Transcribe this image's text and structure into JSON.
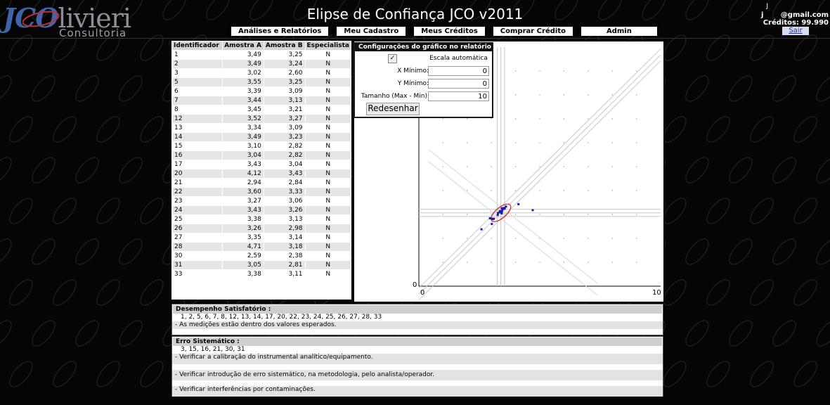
{
  "header": {
    "logo_main": "JCOlivieri",
    "logo_jco": "JCO",
    "logo_rest": "livieri",
    "logo_sub": "Consultoria",
    "title": "Elipse de Confiança JCO v2011"
  },
  "nav": {
    "items": [
      "Análises e Relatórios",
      "Meu Cadastro",
      "Meus Créditos",
      "Comprar Crédito",
      "Admin"
    ]
  },
  "user": {
    "name": "J",
    "email_prefix": "j",
    "email": "@gmail.com",
    "credits": "Créditos: 99.990",
    "logout": "Sair"
  },
  "table": {
    "headers": [
      "Identificador",
      "Amostra A",
      "Amostra B",
      "Especialista"
    ],
    "rows": [
      [
        "1",
        "3,49",
        "3,25",
        "N"
      ],
      [
        "2",
        "3,49",
        "3,24",
        "N"
      ],
      [
        "3",
        "3,02",
        "2,60",
        "N"
      ],
      [
        "5",
        "3,55",
        "3,25",
        "N"
      ],
      [
        "6",
        "3,39",
        "3,09",
        "N"
      ],
      [
        "7",
        "3,44",
        "3,13",
        "N"
      ],
      [
        "8",
        "3,45",
        "3,21",
        "N"
      ],
      [
        "12",
        "3,52",
        "3,27",
        "N"
      ],
      [
        "13",
        "3,34",
        "3,09",
        "N"
      ],
      [
        "14",
        "3,49",
        "3,23",
        "N"
      ],
      [
        "15",
        "3,10",
        "2,82",
        "N"
      ],
      [
        "16",
        "3,04",
        "2,82",
        "N"
      ],
      [
        "17",
        "3,43",
        "3,04",
        "N"
      ],
      [
        "20",
        "4,12",
        "3,43",
        "N"
      ],
      [
        "21",
        "2,94",
        "2,84",
        "N"
      ],
      [
        "22",
        "3,60",
        "3,33",
        "N"
      ],
      [
        "23",
        "3,27",
        "3,06",
        "N"
      ],
      [
        "24",
        "3,43",
        "3,26",
        "N"
      ],
      [
        "25",
        "3,38",
        "3,13",
        "N"
      ],
      [
        "26",
        "3,26",
        "2,98",
        "N"
      ],
      [
        "27",
        "3,35",
        "3,14",
        "N"
      ],
      [
        "28",
        "4,71",
        "3,18",
        "N"
      ],
      [
        "30",
        "2,59",
        "2,38",
        "N"
      ],
      [
        "31",
        "3,05",
        "2,81",
        "N"
      ],
      [
        "33",
        "3,38",
        "3,11",
        "N"
      ]
    ]
  },
  "config": {
    "title": "Configurações do gráfico no relatório",
    "auto_scale_label": "Escala automática",
    "auto_scale_checked": true,
    "check_glyph": "✓",
    "x_min_label": "X Mínimo:",
    "x_min_value": "0",
    "y_min_label": "Y Mínimo:",
    "y_min_value": "0",
    "size_label": "Tamanho (Max - Min):",
    "size_value": "10",
    "redraw_label": "Redesenhar"
  },
  "chart_data": {
    "type": "scatter",
    "x_tick_labels": [
      "0",
      "10"
    ],
    "y_tick_labels": [
      "0"
    ],
    "xlim": [
      0,
      10
    ],
    "ylim": [
      0,
      10
    ],
    "point_color": "#1a1aa6",
    "ellipse_color": "#cc2222",
    "series": [
      {
        "points": [
          [
            3.49,
            3.25
          ],
          [
            3.49,
            3.24
          ],
          [
            3.02,
            2.6
          ],
          [
            3.55,
            3.25
          ],
          [
            3.39,
            3.09
          ],
          [
            3.44,
            3.13
          ],
          [
            3.45,
            3.21
          ],
          [
            3.52,
            3.27
          ],
          [
            3.34,
            3.09
          ],
          [
            3.49,
            3.23
          ],
          [
            3.1,
            2.82
          ],
          [
            3.04,
            2.82
          ],
          [
            3.43,
            3.04
          ],
          [
            4.12,
            3.43
          ],
          [
            2.94,
            2.84
          ],
          [
            3.6,
            3.33
          ],
          [
            3.27,
            3.06
          ],
          [
            3.43,
            3.26
          ],
          [
            3.38,
            3.13
          ],
          [
            3.26,
            2.98
          ],
          [
            3.35,
            3.14
          ],
          [
            4.71,
            3.18
          ],
          [
            2.59,
            2.38
          ],
          [
            3.05,
            2.81
          ],
          [
            3.38,
            3.11
          ]
        ]
      }
    ]
  },
  "results": {
    "satisfactory": {
      "title": "Desempenho Satisfatório :",
      "ids": "1, 2, 5, 6, 7, 8, 12, 13, 14, 17, 20, 22, 23, 24, 25, 26, 27, 28, 33",
      "notes": [
        "- As medições estão dentro dos valores esperados."
      ]
    },
    "systematic": {
      "title": "Erro Sistemático :",
      "ids": "3, 15, 16, 21, 30, 31",
      "notes": [
        "- Verificar a calibração do instrumental analítico/equipamento.",
        "- Verificar introdução de erro sistemático, na metodologia, pelo analista/operador.",
        "- Verificar interferências por contaminações."
      ]
    }
  }
}
